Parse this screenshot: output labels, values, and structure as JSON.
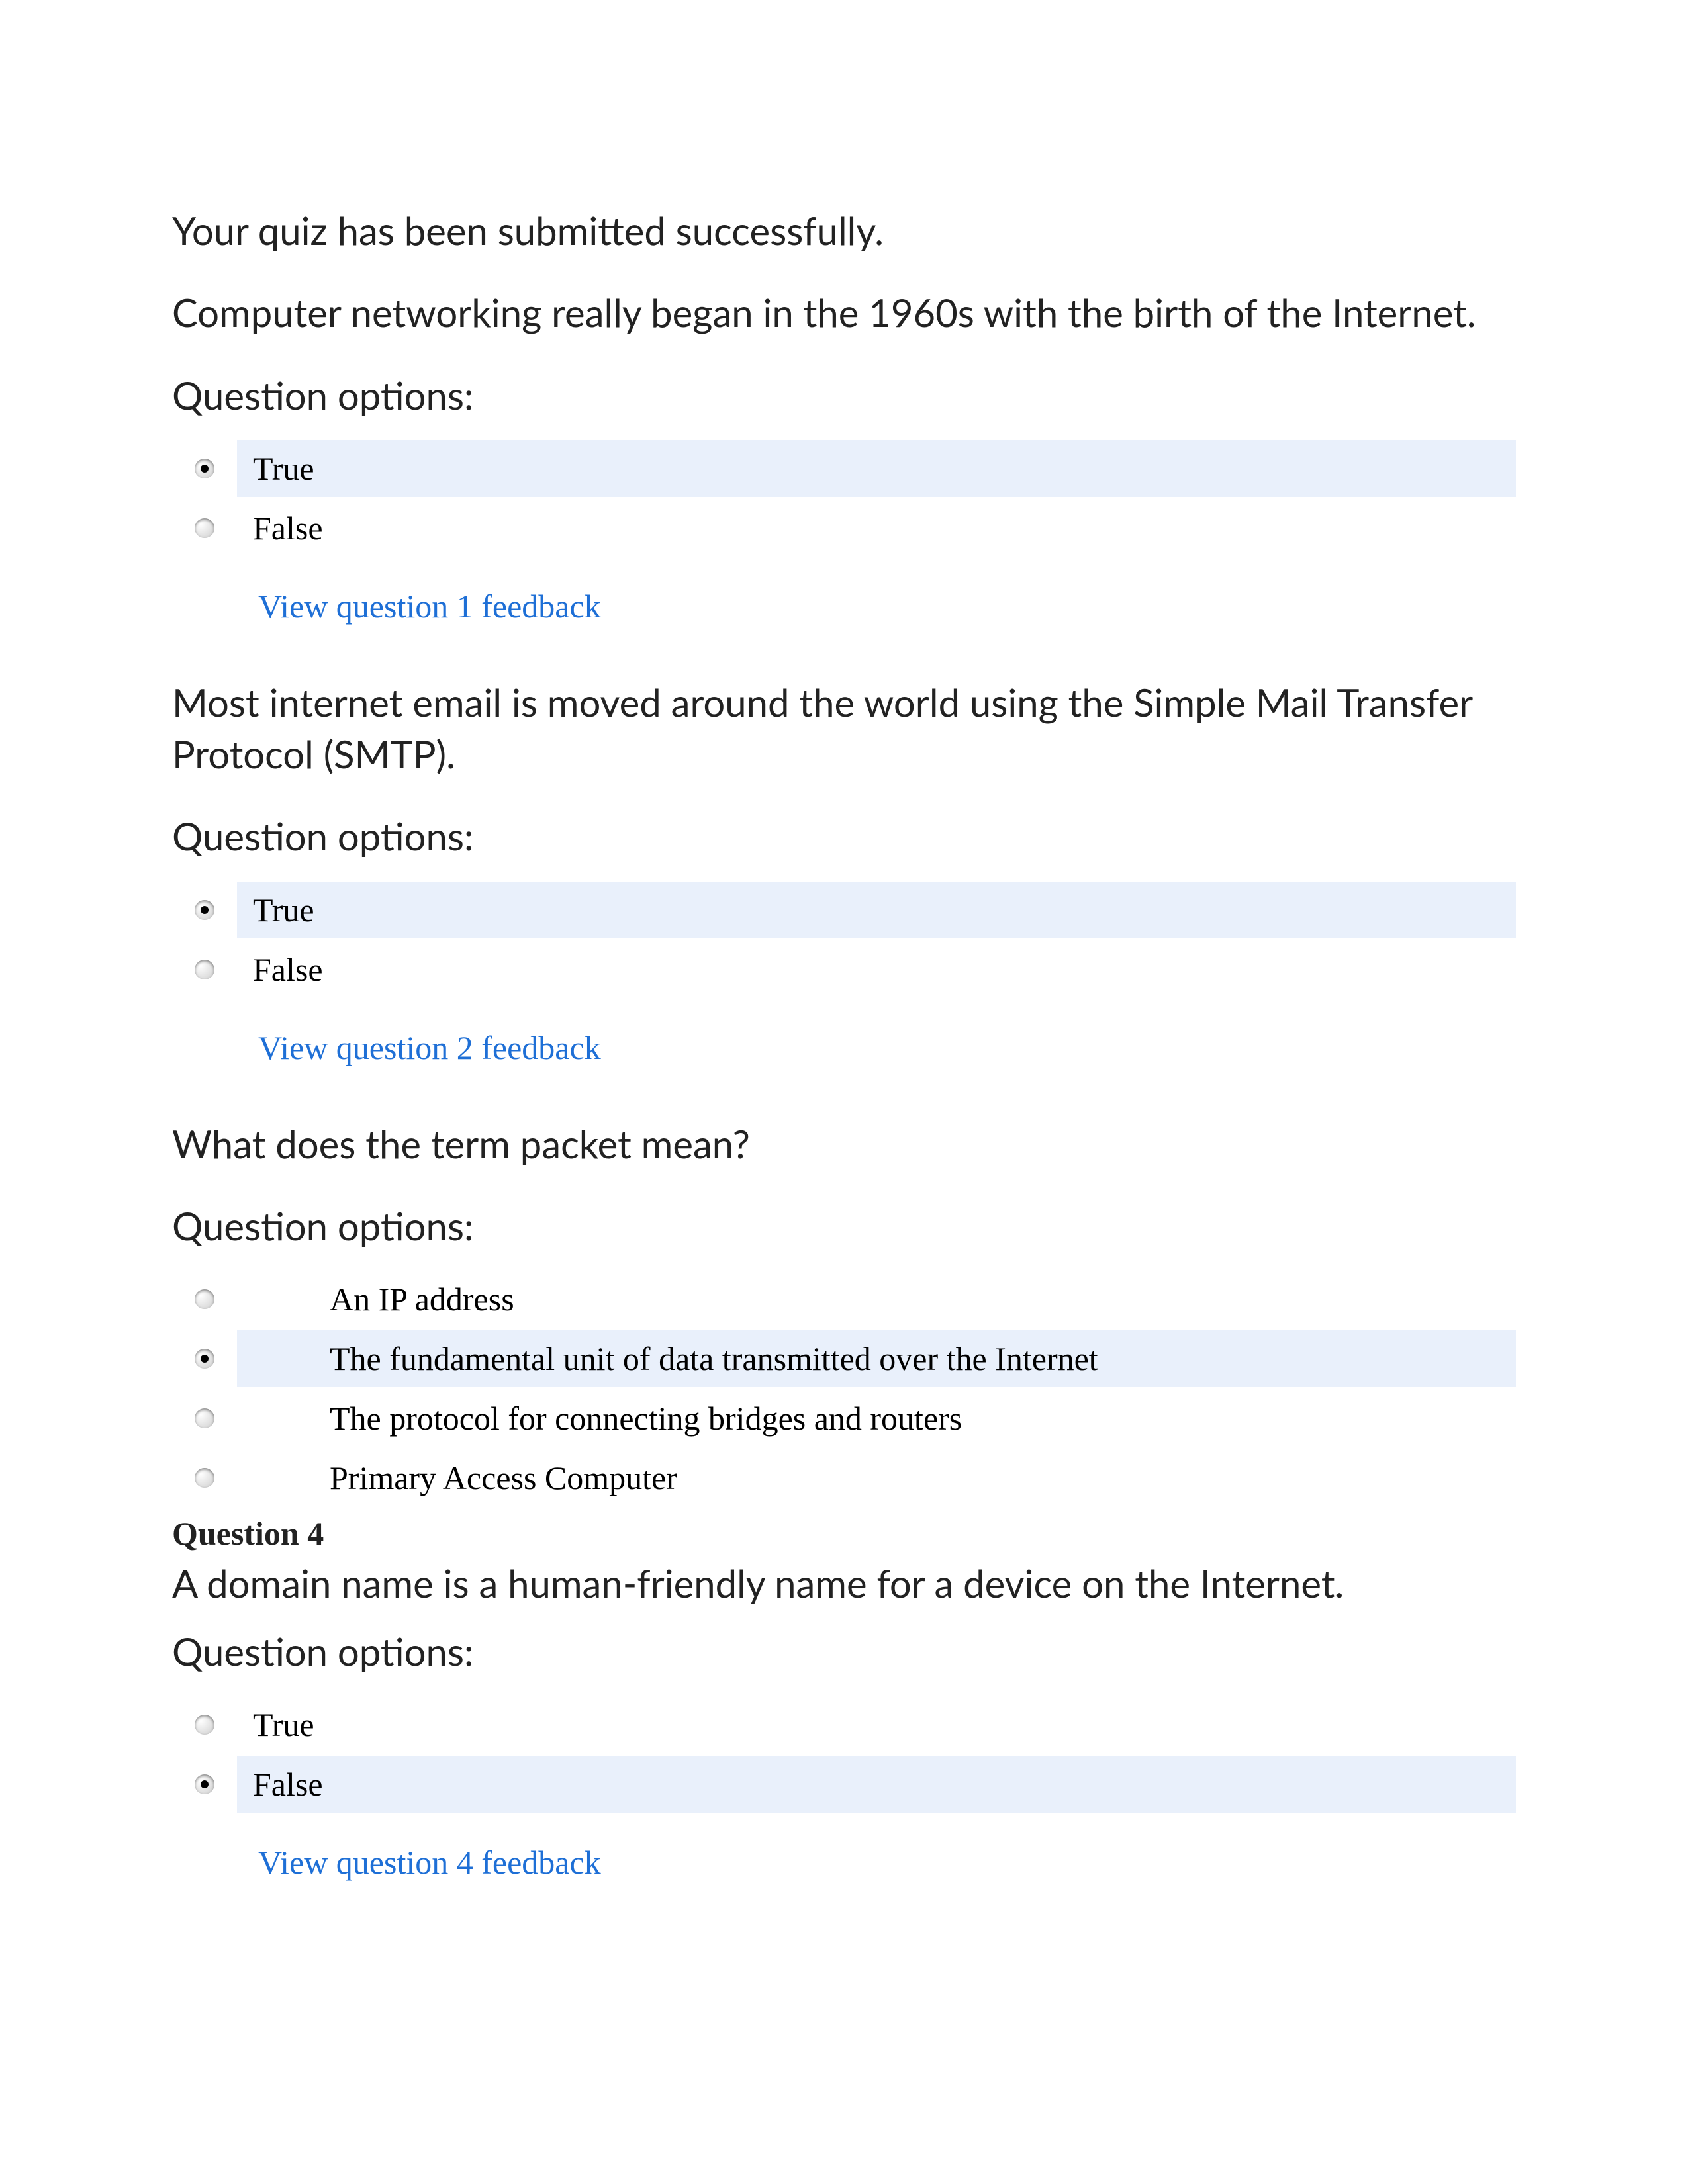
{
  "intro": "Your quiz has been submitted successfully.",
  "options_label": "Question options:",
  "questions": [
    {
      "header": "",
      "prompt": "Computer networking really began in the 1960s with the birth of the Internet.",
      "options": [
        {
          "label": "True",
          "selected": true
        },
        {
          "label": "False",
          "selected": false
        }
      ],
      "wide_labels": false,
      "feedback": "View question 1 feedback"
    },
    {
      "header": "",
      "prompt": "Most internet email is moved around the world using the Simple Mail Transfer Protocol (SMTP).",
      "options": [
        {
          "label": "True",
          "selected": true
        },
        {
          "label": "False",
          "selected": false
        }
      ],
      "wide_labels": false,
      "feedback": "View question 2 feedback"
    },
    {
      "header": "",
      "prompt": "What does the term packet mean?",
      "options": [
        {
          "label": "An IP address",
          "selected": false
        },
        {
          "label": "The fundamental unit of data transmitted over the Internet",
          "selected": true
        },
        {
          "label": "The protocol for connecting bridges and routers",
          "selected": false
        },
        {
          "label": "Primary Access Computer",
          "selected": false
        }
      ],
      "wide_labels": true,
      "feedback": ""
    },
    {
      "header": "Question 4",
      "prompt": "A domain name is a human-friendly name for a device on the Internet.",
      "options": [
        {
          "label": "True",
          "selected": false
        },
        {
          "label": "False",
          "selected": true
        }
      ],
      "wide_labels": false,
      "feedback": "View question 4 feedback"
    }
  ]
}
